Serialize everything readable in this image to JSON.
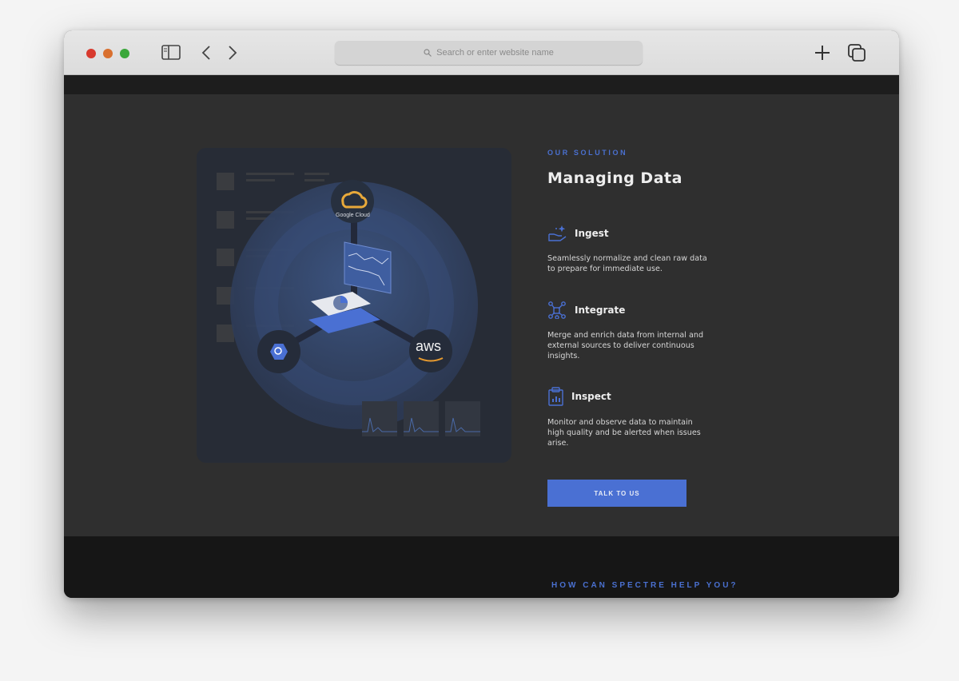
{
  "browser": {
    "address_placeholder": "Search or enter website name"
  },
  "illustration": {
    "google_cloud_label": "Google Cloud",
    "aws_label": "aws"
  },
  "solution": {
    "eyebrow": "OUR SOLUTION",
    "title": "Managing Data",
    "features": [
      {
        "title": "Ingest",
        "icon": "hand-sparkle-icon",
        "description": "Seamlessly normalize and clean raw data to prepare for immediate use."
      },
      {
        "title": "Integrate",
        "icon": "network-nodes-icon",
        "description": "Merge and enrich data from internal and external sources to deliver continuous insights."
      },
      {
        "title": "Inspect",
        "icon": "clipboard-chart-icon",
        "description": "Monitor and observe data to maintain high quality and be alerted when issues arise."
      }
    ],
    "cta_label": "TALK TO US"
  },
  "footer": {
    "heading": "HOW CAN SPECTRE HELP YOU?"
  },
  "colors": {
    "accent": "#4a70d3",
    "content_bg": "#2f2f2f",
    "footer_bg": "#161616"
  }
}
